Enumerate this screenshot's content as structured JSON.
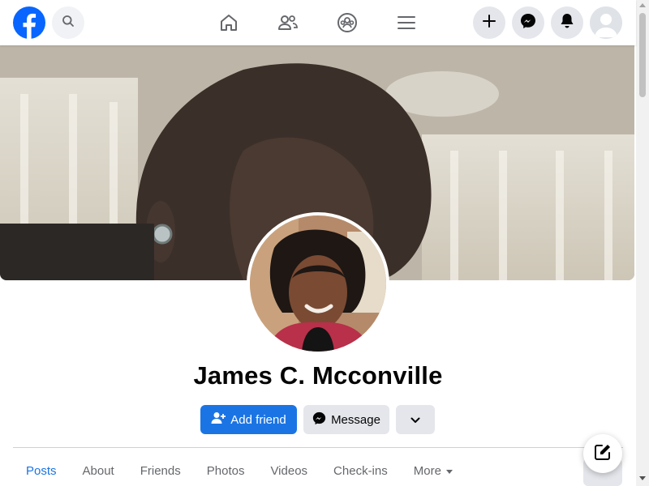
{
  "topbar": {
    "logo_icon": "facebook-logo-icon",
    "search_icon": "search-icon",
    "nav": [
      {
        "icon": "home-icon"
      },
      {
        "icon": "friends-icon"
      },
      {
        "icon": "groups-icon"
      },
      {
        "icon": "menu-icon"
      }
    ],
    "actions": [
      {
        "icon": "plus-icon"
      },
      {
        "icon": "messenger-icon"
      },
      {
        "icon": "bell-icon"
      }
    ]
  },
  "profile": {
    "name": "James C. Mcconville"
  },
  "buttons": {
    "add_friend": "Add friend",
    "message": "Message",
    "more_icon": "chevron-down-icon"
  },
  "tabs": [
    "Posts",
    "About",
    "Friends",
    "Photos",
    "Videos",
    "Check-ins",
    "More"
  ],
  "active_tab": "Posts",
  "colors": {
    "brand": "#1b74e4",
    "button_gray": "#e4e6eb",
    "text_secondary": "#65676b"
  }
}
